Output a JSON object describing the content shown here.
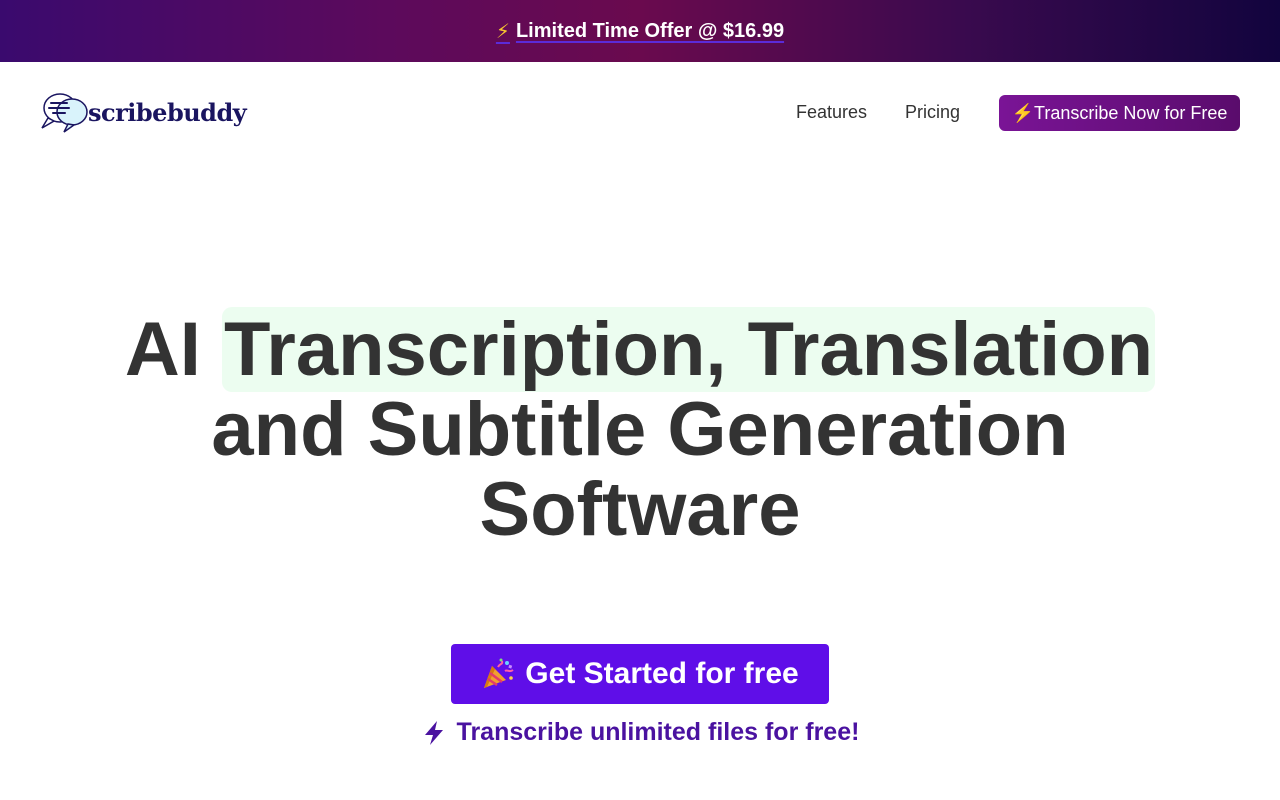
{
  "promo": {
    "bolt": "⚡",
    "text": "Limited Time Offer @ $16.99"
  },
  "brand": {
    "name": "scribebuddy"
  },
  "nav": {
    "features": "Features",
    "pricing": "Pricing",
    "cta_bolt": "⚡",
    "cta_label": "Transcribe Now for Free"
  },
  "hero": {
    "title_pre": "AI ",
    "title_highlight": "Transcription, Translation",
    "title_line2": "and Subtitle Generation",
    "title_line3": "Software"
  },
  "cta": {
    "label": "Get Started for free",
    "icon": "party-popper-icon"
  },
  "note": {
    "icon": "lightning-icon",
    "text": "Transcribe unlimited files for free!"
  },
  "colors": {
    "cta_primary": "#5f0ee8",
    "note_text": "#4a12a0",
    "nav_cta": "#7a1496",
    "highlight_bg": "#ecfdf0"
  }
}
